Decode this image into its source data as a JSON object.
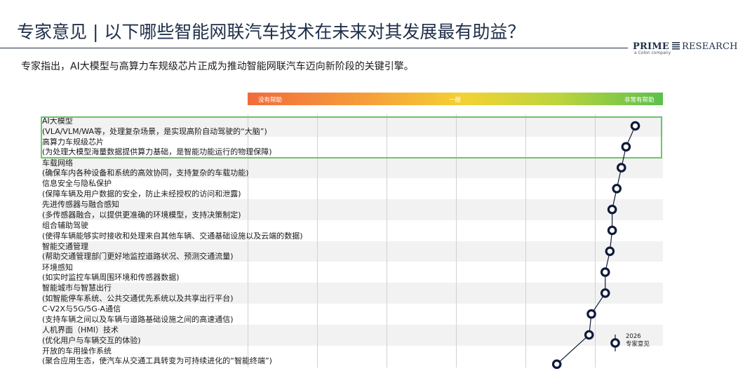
{
  "header": {
    "title": "专家意见 | 以下哪些智能网联汽车技术在未来对其发展最有助益？",
    "subtitle": "专家指出，AI大模型与高算力车规级芯片正成为推动智能网联汽车迈向新阶段的关键引擎。"
  },
  "logo": {
    "prime": "PRIME",
    "research": "RESEARCH",
    "tagline": "a Colon company"
  },
  "colors": {
    "accent": "#1f2f4a",
    "highlight": "#6cc76a",
    "scale_low": "#f26a3c",
    "scale_mid": "#f3d233",
    "scale_high": "#5cc04c",
    "marker": "#0f1a3a"
  },
  "chart_data": {
    "type": "scatter",
    "title": "",
    "scale_labels": [
      "没有帮助",
      "一般",
      "非常有帮助"
    ],
    "legend": {
      "year": "2026",
      "label": "专家意见"
    },
    "xlim": [
      1,
      10
    ],
    "categories": [
      {
        "name": "AI大模型",
        "desc": "(VLA/VLM/WA等，处理复杂场景，是实现高阶自动驾驶的“大脑”)",
        "value": 9.4,
        "highlighted": true
      },
      {
        "name": "高算力车规级芯片",
        "desc": " (为处理大模型海量数据提供算力基础，是智能功能运行的物理保障)",
        "value": 9.2,
        "highlighted": true
      },
      {
        "name": "车载网络",
        "desc": " (确保车内各种设备和系统的高效协同，支持复杂的车载功能)",
        "value": 9.1,
        "highlighted": false
      },
      {
        "name": "信息安全与隐私保护",
        "desc": " (保障车辆及用户数据的安全，防止未经授权的访问和泄露)",
        "value": 9.0,
        "highlighted": false
      },
      {
        "name": "先进传感器与融合感知",
        "desc": " (多传感器融合，以提供更准确的环境模型，支持决策制定)",
        "value": 8.9,
        "highlighted": false
      },
      {
        "name": "组合辅助驾驶",
        "desc": " (使得车辆能够实时接收和处理来自其他车辆、交通基础设施以及云端的数据)",
        "value": 8.9,
        "highlighted": false
      },
      {
        "name": "智能交通管理",
        "desc": " (帮助交通管理部门更好地监控道路状况、预测交通流量)",
        "value": 8.85,
        "highlighted": false
      },
      {
        "name": "环境感知",
        "desc": " (如实时监控车辆周围环境和传感器数据)",
        "value": 8.75,
        "highlighted": false
      },
      {
        "name": "智能城市与智慧出行",
        "desc": " (如智能停车系统、公共交通优先系统以及共享出行平台)",
        "value": 8.75,
        "highlighted": false
      },
      {
        "name": "C-V2X与5G/5G-A通信",
        "desc": " (支持车辆之间以及车辆与道路基础设施之间的高速通信)",
        "value": 8.45,
        "highlighted": false
      },
      {
        "name": "人机界面（HMI）技术",
        "desc": " (优化用户与车辆交互的体验)",
        "value": 8.4,
        "highlighted": false
      },
      {
        "name": "开放的车用操作系统",
        "desc": " (聚合应用生态，使汽车从交通工具转变为可持续进化的“智能终端”)",
        "value": 7.7,
        "highlighted": false
      }
    ]
  }
}
